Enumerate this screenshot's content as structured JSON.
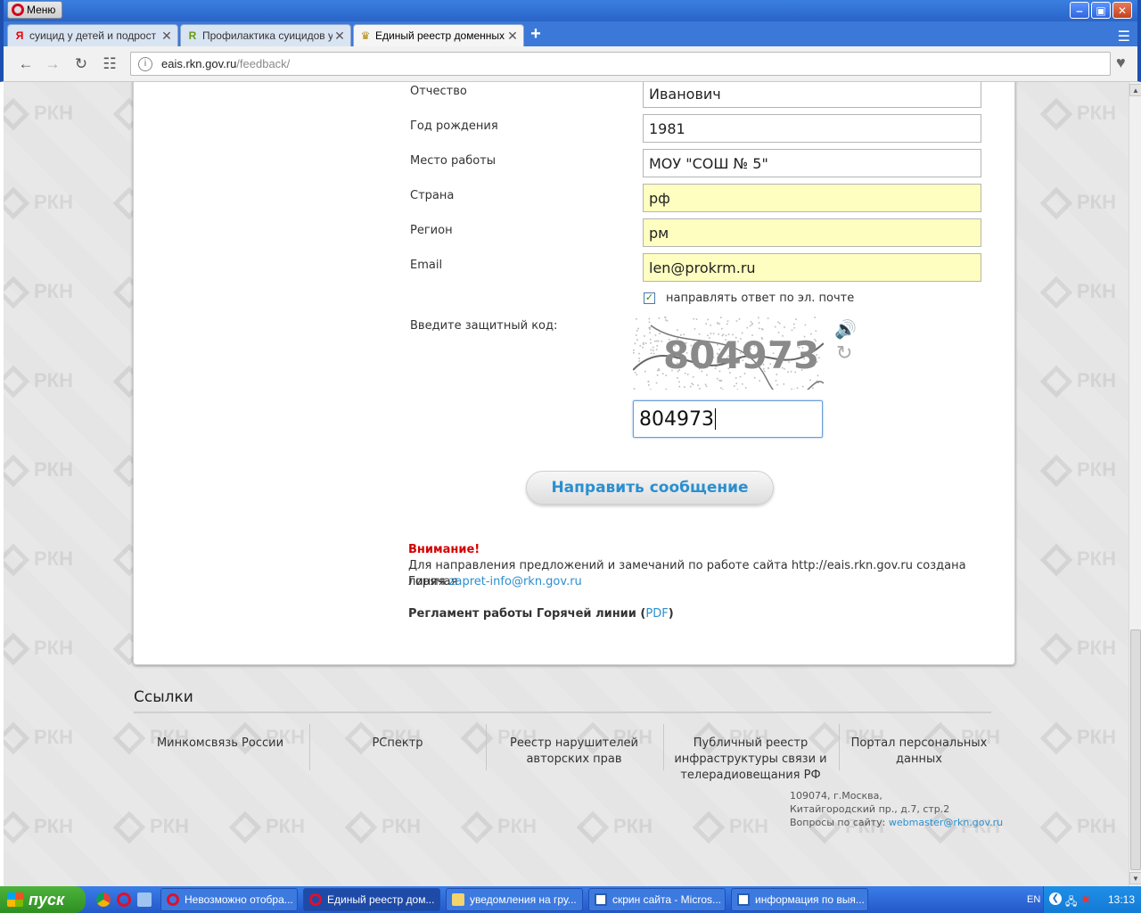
{
  "browser": {
    "menu_label": "Меню",
    "tabs": [
      {
        "title": "суицид у детей и подрост",
        "favicon": "Я"
      },
      {
        "title": "Профилактика суицидов у д",
        "favicon": "R"
      },
      {
        "title": "Единый реестр доменных и",
        "favicon": "♛"
      }
    ],
    "url_host": "eais.rkn.gov.ru",
    "url_path": "/feedback/"
  },
  "form": {
    "fields": [
      {
        "label": "Отчество",
        "value": "Иванович",
        "highlight": false
      },
      {
        "label": "Год рождения",
        "value": "1981",
        "highlight": false
      },
      {
        "label": "Место работы",
        "value": "МОУ \"СОШ № 5\"",
        "highlight": false
      },
      {
        "label": "Страна",
        "value": "рф",
        "highlight": true
      },
      {
        "label": "Регион",
        "value": "рм",
        "highlight": true
      },
      {
        "label": "Email",
        "value": "len@prokrm.ru",
        "highlight": true
      }
    ],
    "email_reply_label": "направлять ответ по эл. почте",
    "email_reply_checked": true,
    "captcha_label": "Введите защитный код:",
    "captcha_image_text": "804973",
    "captcha_value": "804973",
    "submit_label": "Направить сообщение"
  },
  "notice": {
    "title": "Внимание!",
    "text_line1": "Для направления предложений и замечаний по работе сайта http://eais.rkn.gov.ru создана Горячая",
    "text_line2_prefix": "линия",
    "email": "zapret-info@rkn.gov.ru",
    "reglament_prefix": "Регламент работы Горячей линии (",
    "reglament_link": "PDF",
    "reglament_suffix": ")"
  },
  "footer": {
    "links_title": "Ссылки",
    "links": [
      [
        "Минкомсвязь России"
      ],
      [
        "РСпектр"
      ],
      [
        "Реестр нарушителей",
        "авторских прав"
      ],
      [
        "Публичный реестр",
        "инфраструктуры связи и",
        "телерадиовещания РФ"
      ],
      [
        "Портал персональных",
        "данных"
      ]
    ],
    "address_line1": "109074, г.Москва,",
    "address_line2": "Китайгородский пр., д.7, стр.2",
    "questions_prefix": "Вопросы по сайту:",
    "questions_email": "webmaster@rkn.gov.ru",
    "watermark_text": "РКН"
  },
  "taskbar": {
    "start_label": "пуск",
    "tasks": [
      "Невозможно отобра...",
      "Единый реестр дом...",
      "уведомления на гру...",
      "скрин сайта - Micros...",
      "информация по выя..."
    ],
    "language": "EN",
    "clock": "13:13"
  }
}
